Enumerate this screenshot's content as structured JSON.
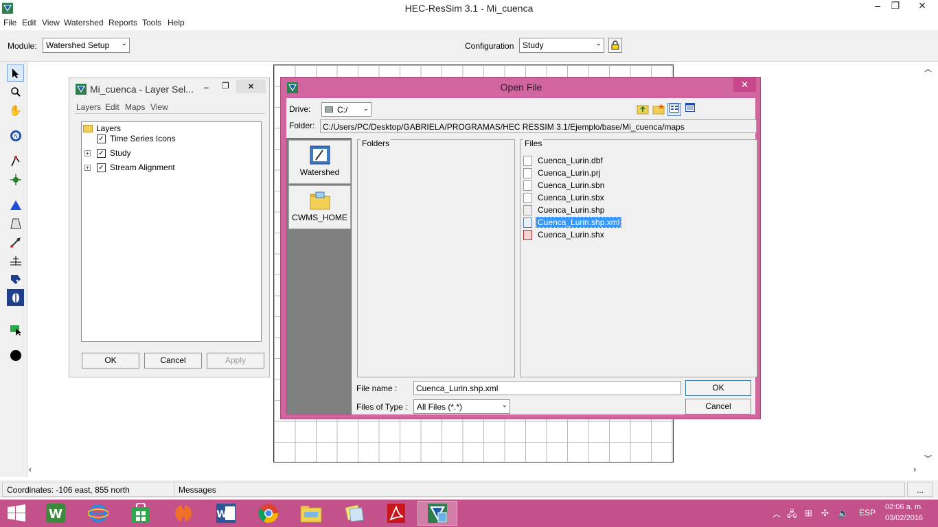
{
  "window": {
    "title": "HEC-ResSim 3.1  - Mi_cuenca",
    "minimize": "–",
    "restore": "❐",
    "close": "✕"
  },
  "menubar": {
    "items": [
      "File",
      "Edit",
      "View",
      "Watershed",
      "Reports",
      "Tools",
      "Help"
    ]
  },
  "modulebar": {
    "module_label": "Module:",
    "module_value": "Watershed Setup",
    "configuration_label": "Configuration",
    "configuration_value": "Study"
  },
  "toolbar": {
    "tools": [
      "pointer-tool",
      "zoom-tool",
      "pan-tool",
      "network-tool",
      "stream-tool",
      "junction-tool",
      "reservoir-tool",
      "dam-tool",
      "diversion-tool",
      "reach-tool",
      "computation-point-tool",
      "time-series-tool",
      "route-tool",
      "node-tool"
    ]
  },
  "layer_selector": {
    "title": "Mi_cuenca - Layer Sel...",
    "minimize": "–",
    "restore": "❐",
    "close": "✕",
    "menu": [
      "Layers",
      "Edit",
      "Maps",
      "View"
    ],
    "root": "Layers",
    "items": [
      {
        "label": "Time Series Icons",
        "checked": true,
        "expandable": false
      },
      {
        "label": "Study",
        "checked": true,
        "expandable": true
      },
      {
        "label": "Stream Alignment",
        "checked": true,
        "expandable": true
      }
    ],
    "ok": "OK",
    "cancel": "Cancel",
    "apply": "Apply"
  },
  "open_file": {
    "title": "Open File",
    "close": "✕",
    "drive_label": "Drive:",
    "drive_value": "C:/",
    "folder_label": "Folder:",
    "folder_value": "C:/Users/PC/Desktop/GABRIELA/PROGRAMAS/HEC RESSIM 3.1/Ejemplo/base/Mi_cuenca/maps",
    "shortcuts": [
      "Watershed",
      "CWMS_HOME"
    ],
    "folders_label": "Folders",
    "files_label": "Files",
    "files": [
      {
        "name": "Cuenca_Lurin.dbf",
        "selected": false
      },
      {
        "name": "Cuenca_Lurin.prj",
        "selected": false
      },
      {
        "name": "Cuenca_Lurin.sbn",
        "selected": false
      },
      {
        "name": "Cuenca_Lurin.sbx",
        "selected": false
      },
      {
        "name": "Cuenca_Lurin.shp",
        "selected": false
      },
      {
        "name": "Cuenca_Lurin.shp.xml",
        "selected": true
      },
      {
        "name": "Cuenca_Lurin.shx",
        "selected": false
      }
    ],
    "file_name_label": "File name :",
    "file_name_value": "Cuenca_Lurin.shp.xml",
    "files_of_type_label": "Files of Type :",
    "files_of_type_value": "All Files (*.*)",
    "ok": "OK",
    "cancel": "Cancel"
  },
  "statusbar": {
    "coordinates": "Coordinates: -106 east, 855 north",
    "messages": "Messages",
    "more": "..."
  },
  "taskbar": {
    "apps": [
      "start",
      "winword-alt",
      "internet-explorer",
      "store",
      "media",
      "word",
      "chrome",
      "file-explorer",
      "sticky-notes",
      "acrobat",
      "hec-ressim"
    ],
    "language": "ESP",
    "time": "02:06 a. m.",
    "date": "03/02/2016"
  },
  "colors": {
    "accent": "#d165a0",
    "taskbar": "#c3528b",
    "selection": "#3399ff"
  }
}
